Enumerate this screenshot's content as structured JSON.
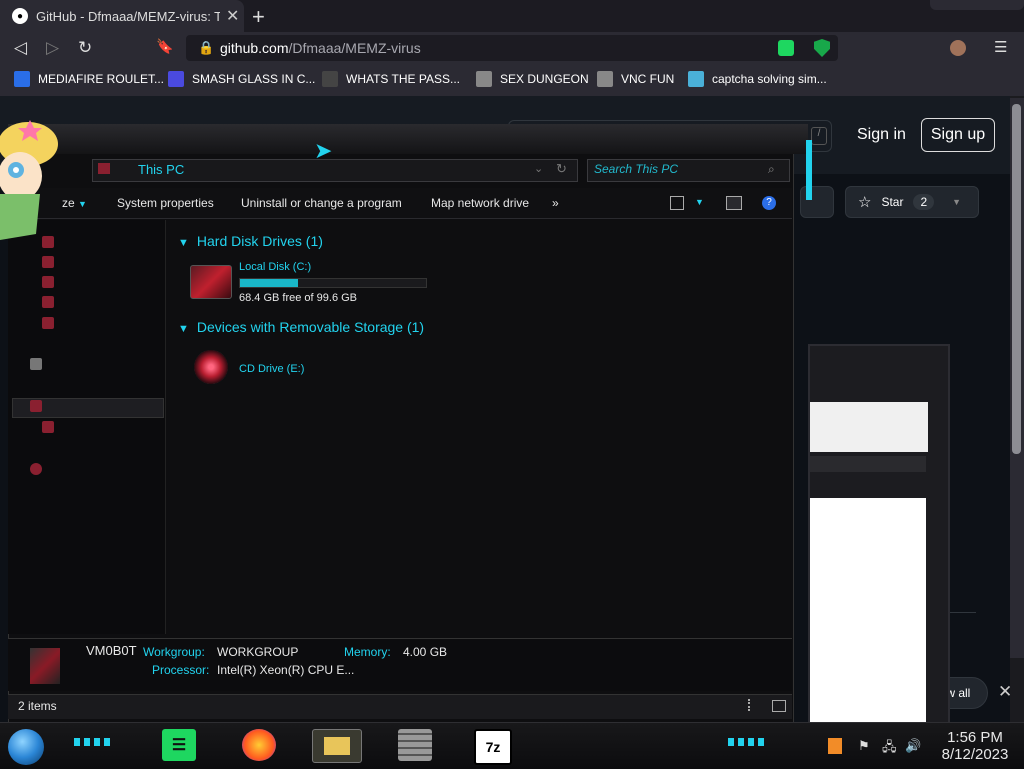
{
  "browser": {
    "tab_title": "GitHub - Dfmaaa/MEMZ-virus: This",
    "tab_close": "✕",
    "new_tab": "+",
    "url_host": "github.com",
    "url_path": "/Dfmaaa/MEMZ-virus",
    "nav": {
      "back": "◁",
      "forward": "▷",
      "reload": "↻",
      "bookmark": "🔖",
      "menu": "☰"
    },
    "bookmarks": [
      {
        "label": "MEDIAFIRE ROULET...",
        "icon_color": "#2a6ee8"
      },
      {
        "label": "SMASH GLASS IN C...",
        "icon_color": "#4a4adf"
      },
      {
        "label": "WHATS THE PASS...",
        "icon_color": "#444444"
      },
      {
        "label": "SEX DUNGEON",
        "icon_color": "#888888"
      },
      {
        "label": "VNC FUN",
        "icon_color": "#888888"
      },
      {
        "label": "captcha solving sim...",
        "icon_color": "#4ab0d8"
      }
    ]
  },
  "github": {
    "sign_in": "Sign in",
    "sign_up": "Sign up",
    "star_label": "Star",
    "star_count": "2",
    "show_all": "ow all",
    "close": "✕",
    "slash_key": "/"
  },
  "explorer": {
    "address": "This PC",
    "search_placeholder": "Search This PC",
    "commands": {
      "organize": "ze",
      "system_properties": "System properties",
      "uninstall": "Uninstall or change a program",
      "map_drive": "Map network drive",
      "more": "»"
    },
    "groups": [
      {
        "header": "Hard Disk Drives (1)"
      },
      {
        "header": "Devices with Removable Storage (1)"
      }
    ],
    "drives": [
      {
        "name": "Local Disk (C:)",
        "free_text": "68.4 GB free of 99.6 GB",
        "used_fraction": 0.313
      },
      {
        "name": "CD Drive (E:)"
      }
    ],
    "details": {
      "computer_name": "VM0B0T",
      "workgroup_label": "Workgroup:",
      "workgroup_value": "WORKGROUP",
      "memory_label": "Memory:",
      "memory_value": "4.00 GB",
      "processor_label": "Processor:",
      "processor_value": "Intel(R) Xeon(R) CPU E..."
    },
    "status": "2 items"
  },
  "taskbar": {
    "time": "1:56 PM",
    "date": "8/12/2023",
    "seven_zip": "7z",
    "colors": {
      "accent": "#22d3ee",
      "green": "#1ed760",
      "firefox": "#ff7a18"
    }
  }
}
